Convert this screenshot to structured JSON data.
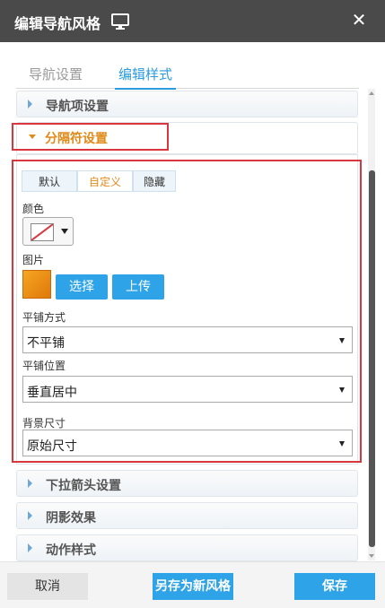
{
  "window": {
    "title": "编辑导航风格",
    "icon": "monitor-icon",
    "close_icon": "close-icon"
  },
  "tabs": [
    {
      "label": "导航设置",
      "active": false
    },
    {
      "label": "编辑样式",
      "active": true
    }
  ],
  "sections": {
    "nav_item": {
      "label": "导航项设置",
      "expanded": false
    },
    "separator": {
      "label": "分隔符设置",
      "expanded": true
    },
    "dropdown_arrow": {
      "label": "下拉箭头设置",
      "expanded": false
    },
    "shadow": {
      "label": "阴影效果",
      "expanded": false
    },
    "action_style": {
      "label": "动作样式",
      "expanded": false
    }
  },
  "separator": {
    "modes": [
      {
        "label": "默认",
        "selected": false
      },
      {
        "label": "自定义",
        "selected": true
      },
      {
        "label": "隐藏",
        "selected": false
      }
    ],
    "color_label": "颜色",
    "image_label": "图片",
    "select_button": "选择",
    "upload_button": "上传",
    "tile_mode_label": "平铺方式",
    "tile_mode_value": "不平铺",
    "tile_position_label": "平铺位置",
    "tile_position_value": "垂直居中",
    "bg_size_label": "背景尺寸",
    "bg_size_value": "原始尺寸"
  },
  "footer": {
    "cancel": "取消",
    "save_as_new": "另存为新风格",
    "save": "保存"
  },
  "colors": {
    "titlebar": "#4a4a4a",
    "accent_blue": "#2fa3e8",
    "active_orange": "#e08a1a",
    "highlight_red": "#d9363e"
  }
}
